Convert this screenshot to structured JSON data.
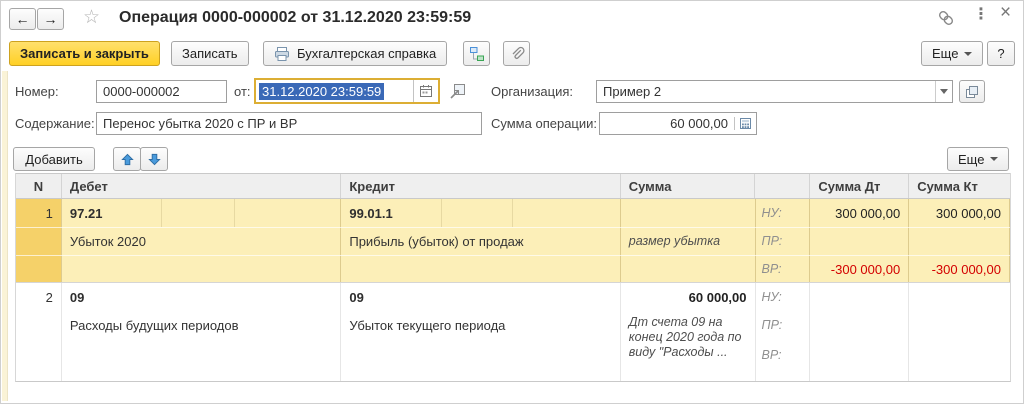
{
  "colors": {
    "accent_yellow": "#ffd024",
    "row_highlight": "#fcefb8",
    "row_number_highlight": "#f5d169",
    "negative_amount": "#d30000",
    "selection_blue": "#3a69b7",
    "table_header_bg": "#efefef",
    "focus_border_gold": "#dcae34"
  },
  "window": {
    "title": "Операция 0000-000002 от 31.12.2020 23:59:59",
    "back_glyph": "←",
    "forward_glyph": "→",
    "star_glyph": "☆",
    "menu_dots_glyph": "⋮",
    "close_glyph": "×"
  },
  "toolbar": {
    "save_close": "Записать и закрыть",
    "save": "Записать",
    "accounting_reference": "Бухгалтерская справка",
    "more": "Еще",
    "help": "?"
  },
  "fields": {
    "number_label": "Номер:",
    "number_value": "0000-000002",
    "date_label": "от:",
    "date_value": "31.12.2020 23:59:59",
    "organization_label": "Организация:",
    "organization_value": "Пример 2",
    "content_label": "Содержание:",
    "content_value": "Перенос убытка 2020 с ПР и ВР",
    "operation_amount_label": "Сумма операции:",
    "operation_amount_value": "60 000,00"
  },
  "table_toolbar": {
    "add": "Добавить",
    "more": "Еще"
  },
  "table": {
    "headers": {
      "n": "N",
      "debit": "Дебет",
      "credit": "Кредит",
      "sum": "Сумма",
      "flags": "",
      "sum_dt": "Сумма Дт",
      "sum_kt": "Сумма Кт"
    },
    "flag_labels": {
      "nu": "НУ:",
      "pr": "ПР:",
      "vr": "ВР:"
    },
    "rows": [
      {
        "n": "1",
        "debit_account": "97.21",
        "debit_subconto": "Убыток 2020",
        "credit_account": "99.01.1",
        "credit_subconto": "Прибыль (убыток) от продаж",
        "sum": "",
        "comment": "размер убытка",
        "nu_dt": "300 000,00",
        "nu_kt": "300 000,00",
        "pr_dt": "",
        "pr_kt": "",
        "vr_dt": "-300 000,00",
        "vr_kt": "-300 000,00"
      },
      {
        "n": "2",
        "debit_account": "09",
        "debit_subconto": "Расходы будущих периодов",
        "credit_account": "09",
        "credit_subconto": "Убыток текущего периода",
        "sum": "60 000,00",
        "comment": "Дт счета 09 на конец 2020 года по виду \"Расходы ...",
        "nu_dt": "",
        "nu_kt": "",
        "pr_dt": "",
        "pr_kt": "",
        "vr_dt": "",
        "vr_kt": ""
      }
    ]
  }
}
